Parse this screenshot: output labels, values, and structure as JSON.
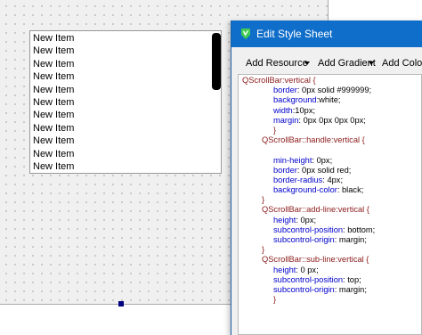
{
  "list_widget": {
    "items": [
      "New Item",
      "New Item",
      "New Item",
      "New Item",
      "New Item",
      "New Item",
      "New Item",
      "New Item",
      "New Item",
      "New Item",
      "New Item"
    ]
  },
  "dialog": {
    "title": "Edit Style Sheet",
    "icon": "qt-designer-icon",
    "toolbar": {
      "add_resource": "Add Resource",
      "add_gradient": "Add Gradient",
      "add_color": "Add Color"
    },
    "stylesheet": [
      {
        "indent": 0,
        "selector": "QScrollBar:vertical {"
      },
      {
        "indent": 2,
        "prop": "border",
        "value": ": 0px solid #999999;"
      },
      {
        "indent": 2,
        "prop": "background",
        "value": ":white;"
      },
      {
        "indent": 2,
        "prop": "width",
        "value": ":10px;"
      },
      {
        "indent": 2,
        "prop": "margin",
        "value": ": 0px 0px 0px 0px;"
      },
      {
        "indent": 2,
        "selector": "}"
      },
      {
        "indent": 1,
        "selector": "QScrollBar::handle:vertical {"
      },
      {
        "indent": 2,
        "selector": ""
      },
      {
        "indent": 2,
        "prop": "min-height",
        "value": ": 0px;"
      },
      {
        "indent": 2,
        "prop": "border",
        "value": ": 0px solid red;"
      },
      {
        "indent": 2,
        "prop": "border-radius",
        "value": ": 4px;"
      },
      {
        "indent": 2,
        "prop": "background-color",
        "value": ": black;"
      },
      {
        "indent": 1,
        "selector": "}"
      },
      {
        "indent": 1,
        "selector": "QScrollBar::add-line:vertical {"
      },
      {
        "indent": 2,
        "prop": "height",
        "value": ": 0px;"
      },
      {
        "indent": 2,
        "prop": "subcontrol-position",
        "value": ": bottom;"
      },
      {
        "indent": 2,
        "prop": "subcontrol-origin",
        "value": ": margin;"
      },
      {
        "indent": 1,
        "selector": "}"
      },
      {
        "indent": 1,
        "selector": "QScrollBar::sub-line:vertical {"
      },
      {
        "indent": 2,
        "prop": "height",
        "value": ": 0 px;"
      },
      {
        "indent": 2,
        "prop": "subcontrol-position",
        "value": ": top;"
      },
      {
        "indent": 2,
        "prop": "subcontrol-origin",
        "value": ": margin;"
      },
      {
        "indent": 2,
        "selector": "}"
      }
    ]
  },
  "colors": {
    "titlebar": "#0f6ec9",
    "selector": "#8b1a1a",
    "property": "#0000cc",
    "scroll_handle": "#000000"
  }
}
